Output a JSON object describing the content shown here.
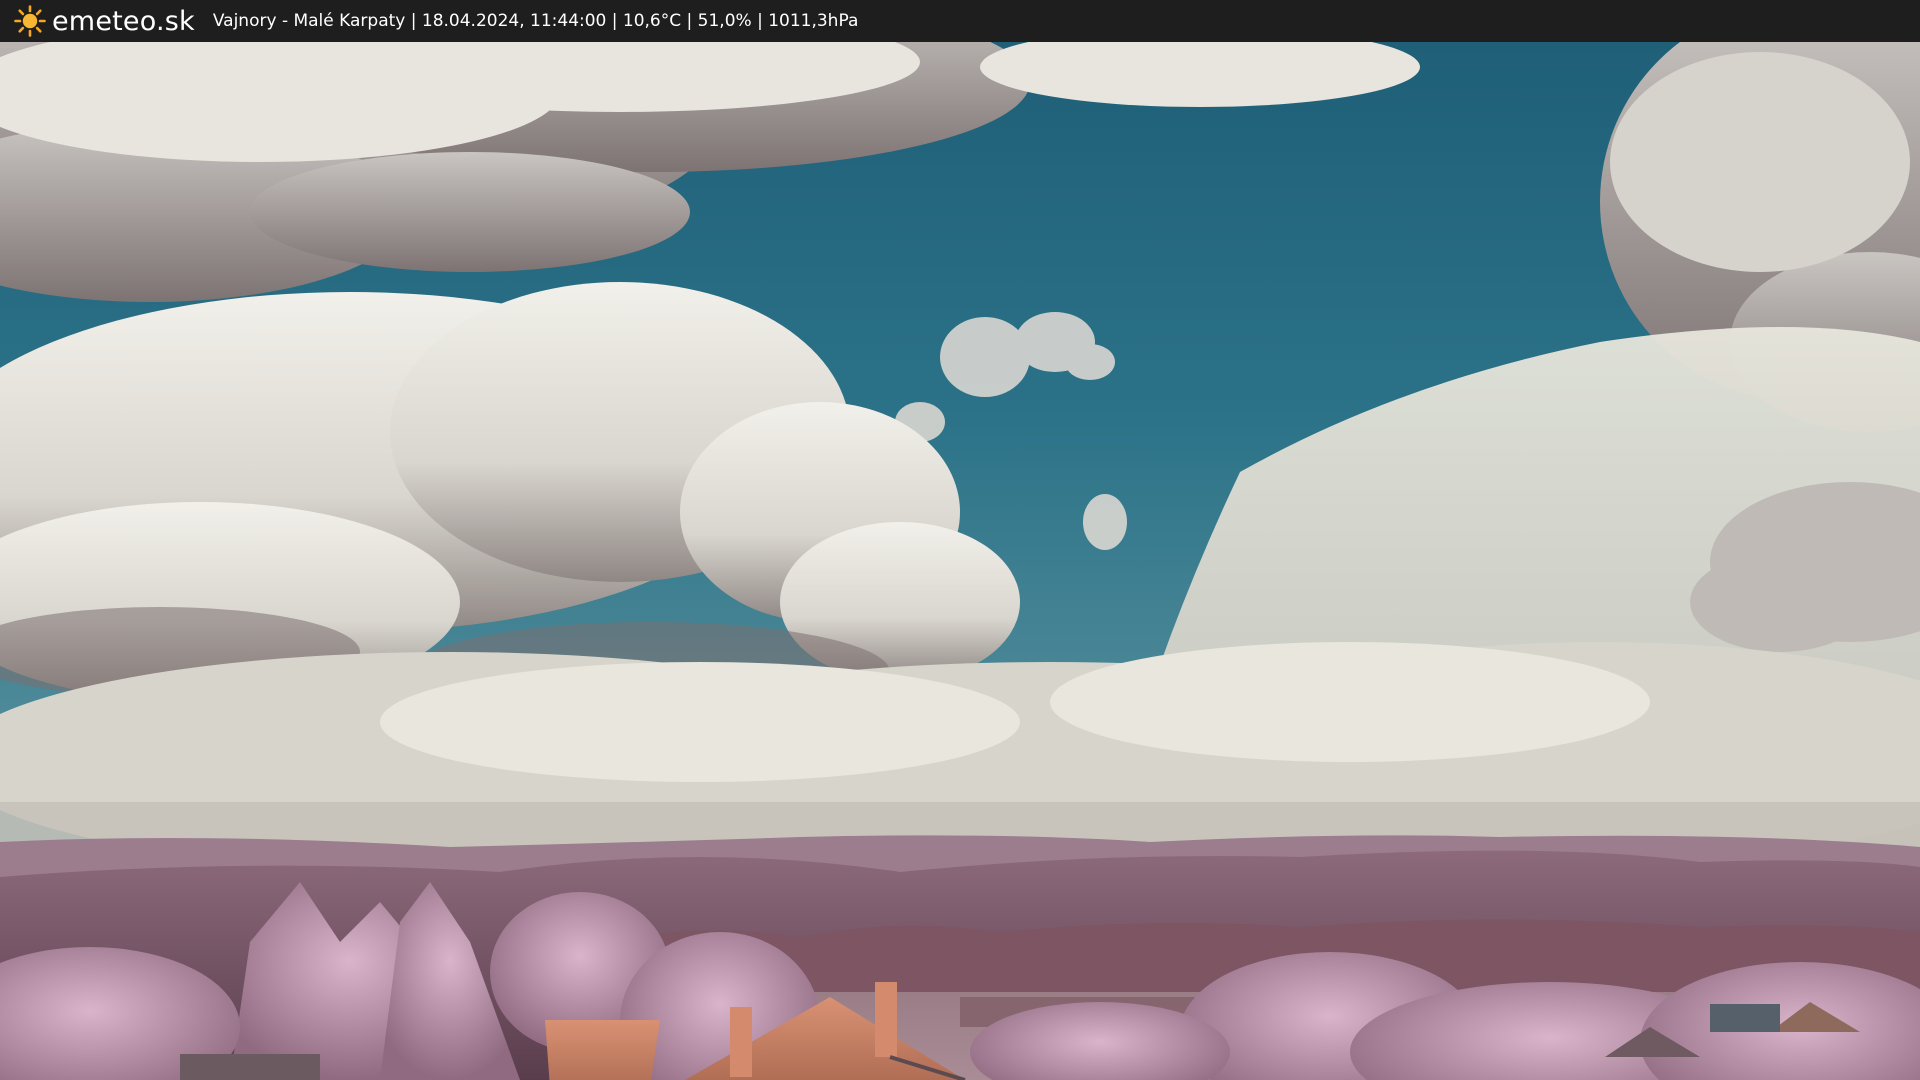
{
  "header": {
    "brand": "emeteo.sk",
    "brand_icon": "sun-icon",
    "info_line": "Vajnory - Malé Karpaty | 18.04.2024, 11:44:00 | 10,6°C | 51,0% | 1011,3hPa"
  },
  "colors": {
    "topbar_bg": "#1e1e1e",
    "sun_orange": "#f5a623",
    "sky": "#2a6e86",
    "foliage": "#b88fa8"
  }
}
